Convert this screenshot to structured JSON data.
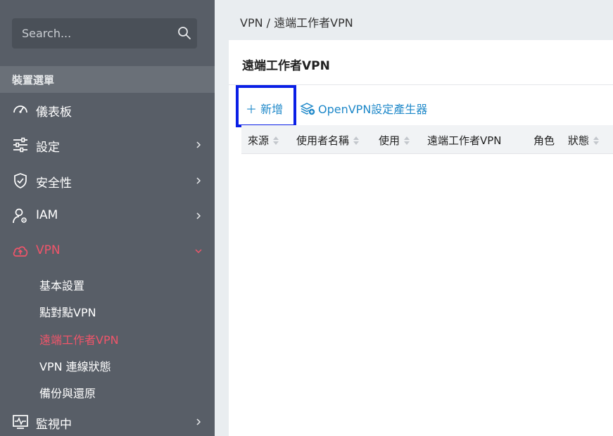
{
  "sidebar": {
    "search_placeholder": "Search...",
    "menu_header": "裝置選單",
    "items": [
      {
        "label": "儀表板",
        "icon": "dashboard-icon"
      },
      {
        "label": "設定",
        "icon": "sliders-icon"
      },
      {
        "label": "安全性",
        "icon": "shield-check-icon"
      },
      {
        "label": "IAM",
        "icon": "user-gear-icon"
      },
      {
        "label": "VPN",
        "icon": "cloud-upload-icon"
      },
      {
        "label": "監視中",
        "icon": "monitor-pulse-icon"
      }
    ],
    "vpn_sub_items": [
      {
        "label": "基本設置"
      },
      {
        "label": "點對點VPN"
      },
      {
        "label": "遠端工作者VPN"
      },
      {
        "label": "VPN 連線狀態"
      },
      {
        "label": "備份與還原"
      }
    ],
    "active_color": "#f0556a"
  },
  "breadcrumb": "VPN / 遠端工作者VPN",
  "panel": {
    "title": "遠端工作者VPN",
    "add_label": "＋ 新增",
    "openvpn_label": "OpenVPN設定產生器",
    "columns": [
      "來源",
      "使用者名稱",
      "使用",
      "遠端工作者VPN",
      "角色",
      "狀態"
    ]
  }
}
